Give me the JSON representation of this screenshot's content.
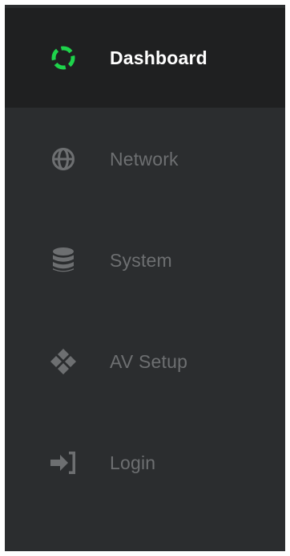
{
  "sidebar": {
    "items": [
      {
        "label": "Dashboard",
        "icon": "dashboard-ring-icon",
        "active": true
      },
      {
        "label": "Network",
        "icon": "globe-icon",
        "active": false
      },
      {
        "label": "System",
        "icon": "database-icon",
        "active": false
      },
      {
        "label": "AV Setup",
        "icon": "diamond-arrows-icon",
        "active": false
      },
      {
        "label": "Login",
        "icon": "sign-in-icon",
        "active": false
      }
    ]
  },
  "colors": {
    "sidebar_bg": "#2b2d2f",
    "active_bg": "#1f2021",
    "accent_green": "#1ed34b",
    "inactive_text": "#6d6f71",
    "active_text": "#ffffff"
  }
}
